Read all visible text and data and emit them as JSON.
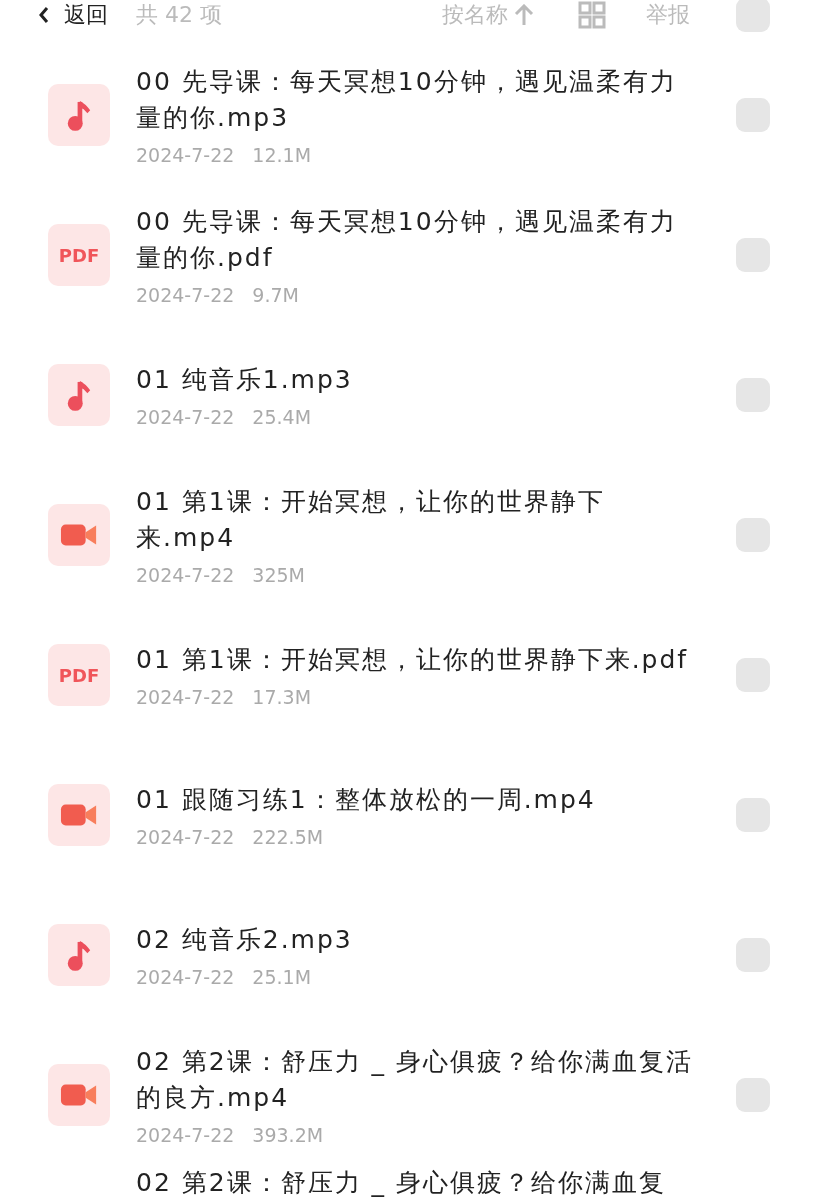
{
  "toolbar": {
    "back": "返回",
    "count": "共 42 项",
    "sort": "按名称",
    "report": "举报",
    "select_all": {
      "selected": false
    }
  },
  "files": [
    {
      "kind": "audio",
      "name": "00 先导课：每天冥想10分钟，遇见温柔有力量的你.mp3",
      "date": "2024-7-22",
      "size": "12.1M",
      "selected": false
    },
    {
      "kind": "pdf",
      "icon_label": "PDF",
      "name": "00 先导课：每天冥想10分钟，遇见温柔有力量的你.pdf",
      "date": "2024-7-22",
      "size": "9.7M",
      "selected": false
    },
    {
      "kind": "audio",
      "name": "01 纯音乐1.mp3",
      "date": "2024-7-22",
      "size": "25.4M",
      "selected": false
    },
    {
      "kind": "video",
      "name": "01 第1课：开始冥想，让你的世界静下来.mp4",
      "date": "2024-7-22",
      "size": "325M",
      "selected": false
    },
    {
      "kind": "pdf",
      "icon_label": "PDF",
      "name": "01 第1课：开始冥想，让你的世界静下来.pdf",
      "date": "2024-7-22",
      "size": "17.3M",
      "selected": false
    },
    {
      "kind": "video",
      "name": "01 跟随习练1：整体放松的一周.mp4",
      "date": "2024-7-22",
      "size": "222.5M",
      "selected": false
    },
    {
      "kind": "audio",
      "name": "02 纯音乐2.mp3",
      "date": "2024-7-22",
      "size": "25.1M",
      "selected": false
    },
    {
      "kind": "video",
      "name": "02 第2课：舒压力 _ 身心俱疲？给你满血复活的良方.mp4",
      "date": "2024-7-22",
      "size": "393.2M",
      "selected": false
    }
  ],
  "partial_row": {
    "name": "02 第2课：舒压力 _ 身心俱疲？给你满血复"
  }
}
